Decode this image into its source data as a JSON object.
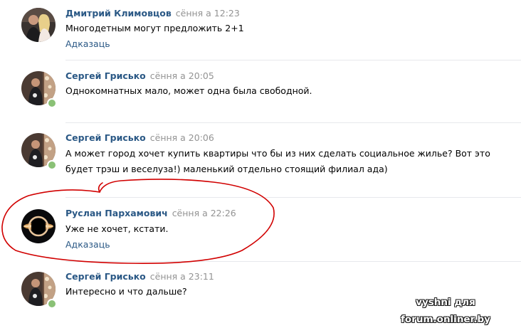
{
  "comments": [
    {
      "author": "Дмитрий Климовцов",
      "date": "сёння а 12:23",
      "text": "Многодетным могут предложить 2+1",
      "reply": "Адказаць",
      "online": false
    },
    {
      "author": "Сергей Грисько",
      "date": "сёння а 20:05",
      "text": "Однокомнатных мало, может одна была свободной.",
      "reply": "",
      "online": true
    },
    {
      "author": "Сергей Грисько",
      "date": "сёння а 20:06",
      "text": "А может город хочет купить квартиры что бы из них сделать социальное жилье? Вот это будет трэш и веселуза!) маленький отдельно стоящий филиал ада)",
      "reply": "",
      "online": true
    },
    {
      "author": "Руслан Пархамович",
      "date": "сёння а 22:26",
      "text": "Уже не хочет, кстати.",
      "reply": "Адказаць",
      "online": false
    },
    {
      "author": "Сергей Грисько",
      "date": "сёння а 23:11",
      "text": "Интересно и что дальше?",
      "reply": "",
      "online": true
    }
  ],
  "watermark": "vyshni для forum.onliner.by",
  "colors": {
    "author": "#2a5885",
    "date": "#939393",
    "online": "#8ac176",
    "highlight": "#d10000"
  }
}
